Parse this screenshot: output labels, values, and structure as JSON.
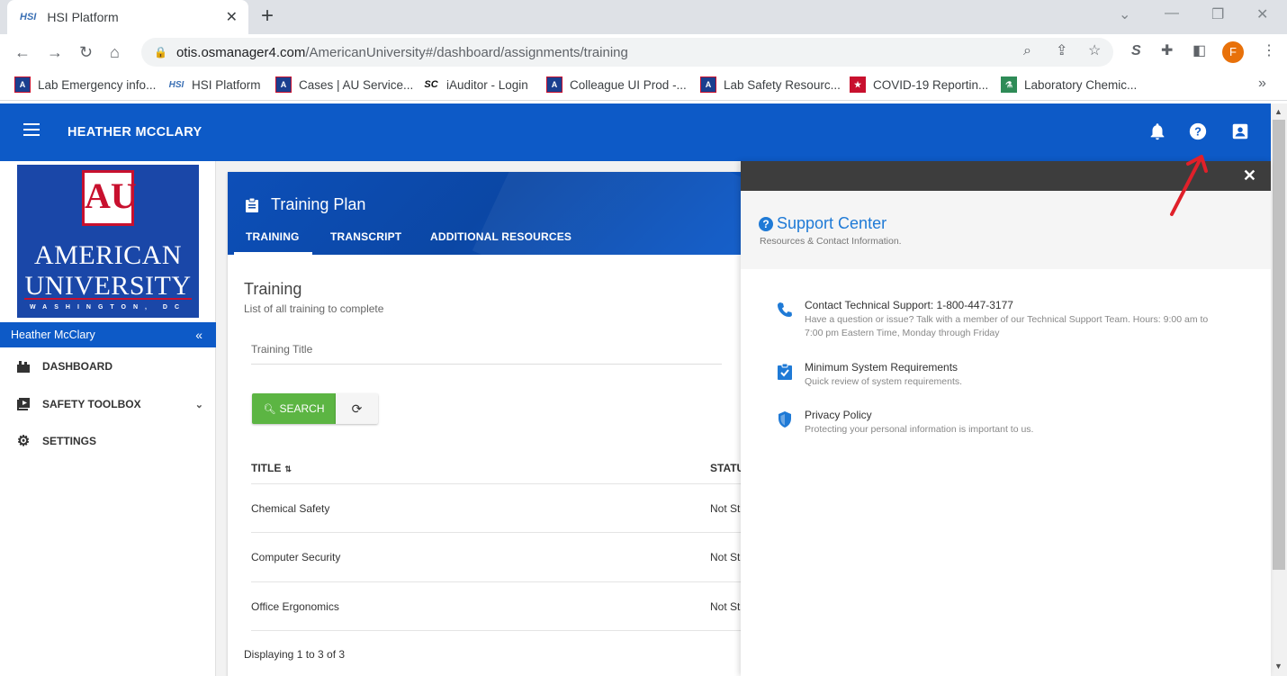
{
  "browser": {
    "tab_title": "HSI Platform",
    "tab_favicon": "HSI",
    "url_host": "otis.osmanager4.com",
    "url_path": "/AmericanUniversity#/dashboard/assignments/training",
    "profile_initial": "F",
    "extension_letter": "S",
    "bookmarks": [
      {
        "label": "Lab Emergency info...",
        "icon": "AU"
      },
      {
        "label": "HSI Platform",
        "icon": "HSI"
      },
      {
        "label": "Cases | AU Service...",
        "icon": "AU"
      },
      {
        "label": "iAuditor - Login",
        "icon": "SC"
      },
      {
        "label": "Colleague UI Prod -...",
        "icon": "AU"
      },
      {
        "label": "Lab Safety Resourc...",
        "icon": "AU"
      },
      {
        "label": "COVID-19 Reportin...",
        "icon": "flag"
      },
      {
        "label": "Laboratory Chemic...",
        "icon": "flask"
      }
    ],
    "bookmarks_more": "»"
  },
  "appbar": {
    "user_name": "HEATHER MCCLARY"
  },
  "sidebar": {
    "logo": {
      "mark": "AU",
      "line1": "AMERICAN",
      "line2": "UNIVERSITY",
      "line3": "WASHINGTON, DC"
    },
    "user": "Heather McClary",
    "collapse": "«",
    "items": [
      {
        "label": "DASHBOARD"
      },
      {
        "label": "SAFETY TOOLBOX"
      },
      {
        "label": "SETTINGS"
      }
    ]
  },
  "training": {
    "header_title": "Training Plan",
    "tabs": [
      "TRAINING",
      "TRANSCRIPT",
      "ADDITIONAL RESOURCES"
    ],
    "section_title": "Training",
    "section_subtitle": "List of all training to complete",
    "filter_placeholder": "Training Title",
    "search_label": "SEARCH",
    "columns": [
      "TITLE",
      "STATU"
    ],
    "rows": [
      {
        "title": "Chemical Safety",
        "status": "Not St"
      },
      {
        "title": "Computer Security",
        "status": "Not St"
      },
      {
        "title": "Office Ergonomics",
        "status": "Not St"
      }
    ],
    "footer": "Displaying 1 to 3 of 3"
  },
  "support": {
    "title": "Support Center",
    "subtitle": "Resources & Contact Information.",
    "items": [
      {
        "heading": "Contact Technical Support: 1-800-447-3177",
        "desc": "Have a question or issue? Talk with a member of our Technical Support Team. Hours: 9:00 am to 7:00 pm Eastern Time, Monday through Friday"
      },
      {
        "heading": "Minimum System Requirements",
        "desc": "Quick review of system requirements."
      },
      {
        "heading": "Privacy Policy",
        "desc": "Protecting your personal information is important to us."
      }
    ]
  },
  "colors": {
    "brand_blue": "#0d5ac7",
    "search_green": "#5cb543",
    "support_blue": "#1f7ad6",
    "annotation_red": "#e0202a"
  }
}
